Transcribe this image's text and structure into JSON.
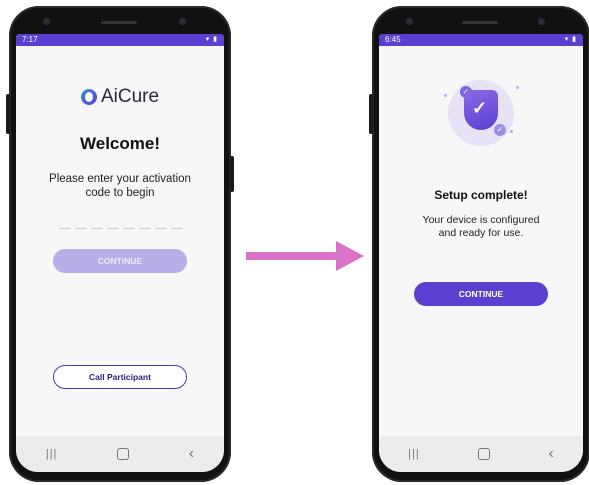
{
  "left_phone": {
    "status_time": "7:17",
    "logo_text": "AiCure",
    "title": "Welcome!",
    "prompt": "Please enter your activation code to begin",
    "continue_label": "CONTINUE",
    "call_label": "Call Participant"
  },
  "right_phone": {
    "status_time": "6:45",
    "title": "Setup complete!",
    "message": "Your device is configured and ready for use.",
    "continue_label": "CONTINUE"
  },
  "colors": {
    "brand_purple": "#5b3fd1",
    "disabled_purple": "#b8aee8",
    "arrow_pink": "#d873c8"
  },
  "icons": [
    "aicure-logo",
    "shield-check-icon",
    "arrow-right-icon",
    "recent-apps-icon",
    "home-icon",
    "back-icon"
  ]
}
